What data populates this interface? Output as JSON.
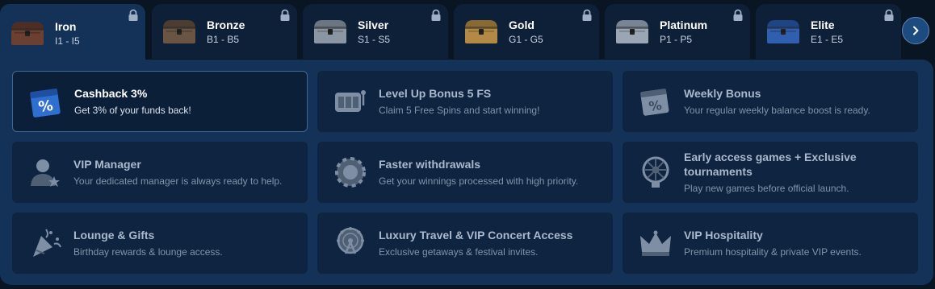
{
  "tiers": [
    {
      "name": "Iron",
      "range": "I1 - I5",
      "locked": true,
      "active": true,
      "icon": "iron-chest-icon"
    },
    {
      "name": "Bronze",
      "range": "B1 - B5",
      "locked": true,
      "active": false,
      "icon": "bronze-chest-icon"
    },
    {
      "name": "Silver",
      "range": "S1 - S5",
      "locked": true,
      "active": false,
      "icon": "silver-chest-icon"
    },
    {
      "name": "Gold",
      "range": "G1 - G5",
      "locked": true,
      "active": false,
      "icon": "gold-chest-icon"
    },
    {
      "name": "Platinum",
      "range": "P1 - P5",
      "locked": true,
      "active": false,
      "icon": "platinum-chest-icon"
    },
    {
      "name": "Elite",
      "range": "E1 - E5",
      "locked": true,
      "active": false,
      "icon": "elite-chest-icon"
    }
  ],
  "next_icon": "chevron-right-icon",
  "benefits": [
    {
      "title": "Cashback 3%",
      "desc": "Get 3% of your funds back!",
      "icon": "cashback-calendar-icon",
      "active": true
    },
    {
      "title": "Level Up Bonus 5 FS",
      "desc": "Claim 5 Free Spins and start winning!",
      "icon": "slot-machine-icon",
      "active": false
    },
    {
      "title": "Weekly Bonus",
      "desc": "Your regular weekly balance boost is ready.",
      "icon": "weekly-calendar-icon",
      "active": false
    },
    {
      "title": "VIP Manager",
      "desc": "Your dedicated manager is always ready to help.",
      "icon": "manager-icon",
      "active": false
    },
    {
      "title": "Faster withdrawals",
      "desc": "Get your winnings processed with high priority.",
      "icon": "chip-icon",
      "active": false
    },
    {
      "title": "Early access games + Exclusive tournaments",
      "desc": "Play new games before official launch.",
      "icon": "roulette-icon",
      "active": false
    },
    {
      "title": "Lounge & Gifts",
      "desc": "Birthday rewards & lounge access.",
      "icon": "party-popper-icon",
      "active": false
    },
    {
      "title": "Luxury Travel & VIP Concert Access",
      "desc": "Exclusive getaways & festival invites.",
      "icon": "ferris-wheel-icon",
      "active": false
    },
    {
      "title": "VIP Hospitality",
      "desc": "Premium hospitality & private VIP events.",
      "icon": "crown-icon",
      "active": false
    }
  ],
  "colors": {
    "panel": "#143257",
    "card": "#0e2440",
    "tab": "#0e2038",
    "accent": "#1c4b80",
    "iron": "#6b3f32",
    "bronze": "#6a5544",
    "silver": "#8a96a3",
    "gold": "#b28a45",
    "platinum": "#9aa6b4",
    "elite": "#2f5fae"
  }
}
